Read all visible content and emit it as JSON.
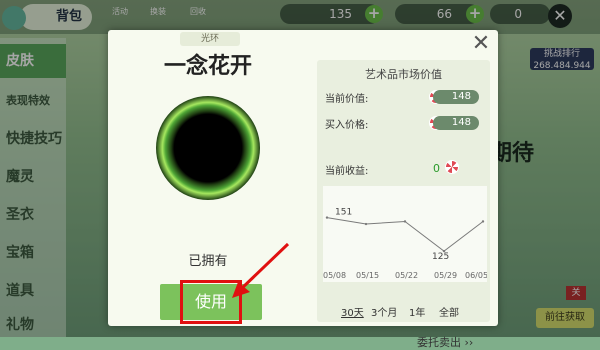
{
  "header": {
    "backpack_label": "背包",
    "tool_labels": [
      "活动",
      "换装",
      "回收"
    ],
    "gold": "135",
    "candy": "66",
    "gem": "0"
  },
  "sidebar": {
    "items": [
      {
        "label": "皮肤"
      },
      {
        "label": "表现特效"
      },
      {
        "label": "快捷技巧"
      },
      {
        "label": "魔灵"
      },
      {
        "label": "圣衣"
      },
      {
        "label": "宝箱"
      },
      {
        "label": "道具"
      },
      {
        "label": "礼物"
      }
    ]
  },
  "modal": {
    "category": "光环",
    "item_name": "一念花开",
    "owned_text": "已拥有",
    "use_label": "使用"
  },
  "market": {
    "title": "艺术品市场价值",
    "current_value_label": "当前价值:",
    "current_value": "148",
    "buy_price_label": "买入价格:",
    "buy_price": "148",
    "profit_label": "当前收益:",
    "profit": "0",
    "consign_label": "委托卖出 ››",
    "ranges": [
      "30天",
      "3个月",
      "1年",
      "全部"
    ]
  },
  "chart_data": {
    "type": "line",
    "x": [
      "05/08",
      "05/15",
      "05/22",
      "05/29",
      "06/05"
    ],
    "series": [
      {
        "values": [
          151,
          146,
          148,
          125,
          148
        ]
      }
    ],
    "annotations": [
      "151",
      "125"
    ]
  },
  "background": {
    "score_title": "挑战排行",
    "score_value": "268.484.944",
    "partial_word": "期待",
    "toggle_label": "关",
    "goto_label": "前往获取"
  },
  "colors": {
    "accent": "#7cc25c",
    "highlight": "#e01010"
  }
}
